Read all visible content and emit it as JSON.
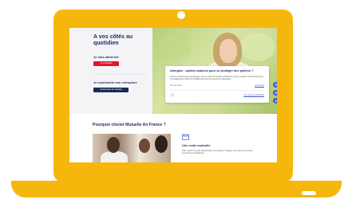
{
  "hero": {
    "title": "A vos côtés au\nquotidien",
    "member_heading": "Je suis adhérent",
    "member_button": "Je m'identifie",
    "company_heading": "Je représente une entreprise",
    "company_button": "Je découvre la mutuelle"
  },
  "article_card": {
    "title": "Allergies : quelles astuces pour se protéger des pollens ?",
    "excerpt": "Comment éviter toutes les allergies, avec le retour de la saison printanière pour les pollens. Comment prévenir ou désagrément profite être fondamental pour les personnes allergiques.",
    "date": "05 mars 2021",
    "read_link": "Lire l'article",
    "all_link": "Voir toutes les actualités",
    "arrow_icon": "arrow-left-icon"
  },
  "floating_buttons": [
    "phone-icon",
    "mail-icon",
    "location-icon"
  ],
  "why": {
    "title": "Pourquoi choisir Mutuelle Air France ?",
    "feature_icon": "calendar-icon",
    "feature_title": "Une vraie mutuelle",
    "feature_text": "Chez nous il n'y a pas d'actionnaires à rémunérer ! Chaque euro cotisé est réinvesti au profit de nos adhérents."
  },
  "colors": {
    "frame": "#f6b70d",
    "navy": "#1c2a5c",
    "red": "#e3152f",
    "blue": "#3b5bdb"
  }
}
